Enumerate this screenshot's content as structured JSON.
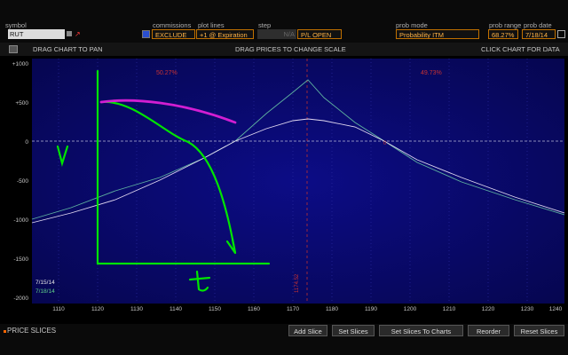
{
  "header": {
    "symbol_label": "symbol",
    "symbol_value": "RUT",
    "commissions_label": "commissions",
    "commissions_value": "EXCLUDE",
    "plot_lines_label": "plot lines",
    "plot_lines_value": "+1 @ Expiration",
    "step_label": "step",
    "step_value": "N/A",
    "pl_mode_value": "P/L OPEN",
    "prob_mode_label": "prob mode",
    "prob_mode_value": "Probability ITM",
    "prob_range_label": "prob range",
    "prob_range_value": "68.27%",
    "prob_date_label": "prob date",
    "prob_date_value": "7/18/14"
  },
  "toolbar": {
    "drag_pan": "DRAG CHART TO PAN",
    "drag_scale": "DRAG PRICES TO CHANGE SCALE",
    "click_data": "CLICK CHART FOR DATA"
  },
  "chart": {
    "y_ticks": [
      "+1000",
      "+500",
      "0",
      "-500",
      "-1000",
      "-1500",
      "-2000"
    ],
    "x_ticks": [
      "1110",
      "1120",
      "1130",
      "1140",
      "1150",
      "1160",
      "1170",
      "1180",
      "1190",
      "1200",
      "1210",
      "1220",
      "1230",
      "1240"
    ],
    "prob_left": "50.27%",
    "prob_right": "49.73%",
    "price_marker": "1174.52",
    "strike_marker": "0",
    "date_1": "7/15/14",
    "date_2": "7/18/14",
    "annotation_v": "V",
    "annotation_t": "t",
    "colors": {
      "background": "#0a0a6e",
      "expiration_line": "#5fb3a0",
      "current_line": "#e0d8f0",
      "drawing_green": "#00e400",
      "drawing_magenta": "#d21ed2",
      "probability_text": "#c83232"
    }
  },
  "bottom": {
    "title": "PRICE SLICES",
    "add_slice": "Add Slice",
    "set_slices": "Set Slices",
    "set_slices_charts": "Set Slices To Charts",
    "reorder": "Reorder",
    "reset_slices": "Reset Slices"
  }
}
